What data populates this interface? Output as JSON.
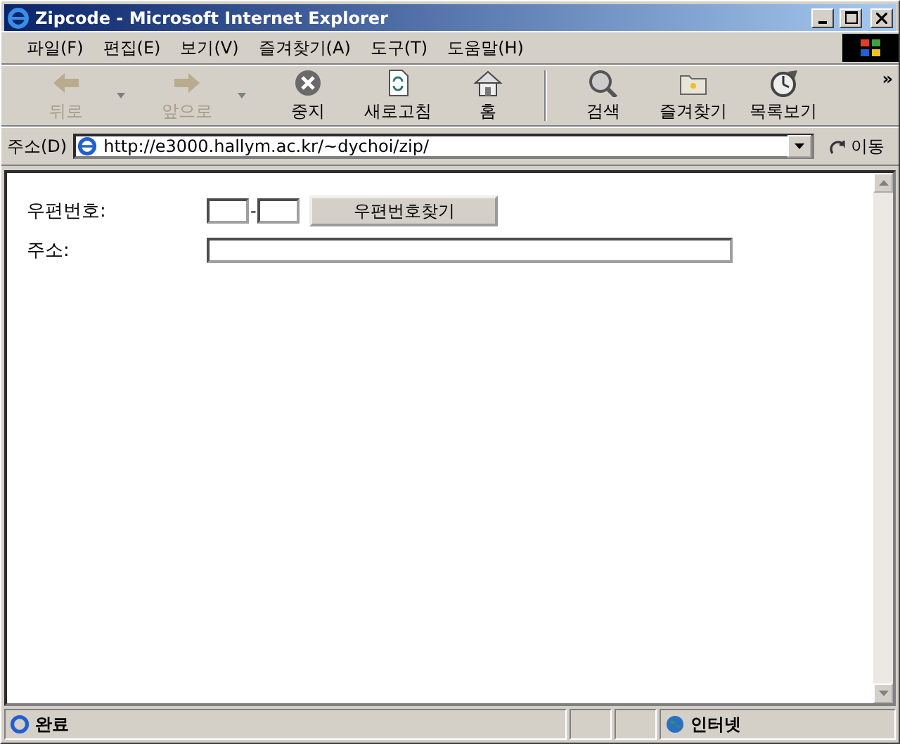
{
  "window": {
    "title": "Zipcode - Microsoft Internet Explorer"
  },
  "menu": [
    "파일(F)",
    "편집(E)",
    "보기(V)",
    "즐겨찾기(A)",
    "도구(T)",
    "도움말(H)"
  ],
  "toolbar": [
    {
      "label": "뒤로",
      "disabled": true,
      "dropdown": true
    },
    {
      "label": "앞으로",
      "disabled": true,
      "dropdown": true
    },
    {
      "label": "중지",
      "disabled": false,
      "dropdown": false
    },
    {
      "label": "새로고침",
      "disabled": false,
      "dropdown": false
    },
    {
      "label": "홈",
      "disabled": false,
      "dropdown": false
    },
    {
      "label": "검색",
      "disabled": false,
      "dropdown": false
    },
    {
      "label": "즐겨찾기",
      "disabled": false,
      "dropdown": false
    },
    {
      "label": "목록보기",
      "disabled": false,
      "dropdown": false
    }
  ],
  "toolbar_more": "»",
  "address": {
    "label": "주소(D)",
    "value": "http://e3000.hallym.ac.kr/~dychoi/zip/",
    "go": "이동"
  },
  "form": {
    "zip_label": "우편번호:",
    "zip_sep": "-",
    "zip_button": "우편번호찾기",
    "address_label": "주소:"
  },
  "status_bar": {
    "text": "완료",
    "zone": "인터넷"
  }
}
